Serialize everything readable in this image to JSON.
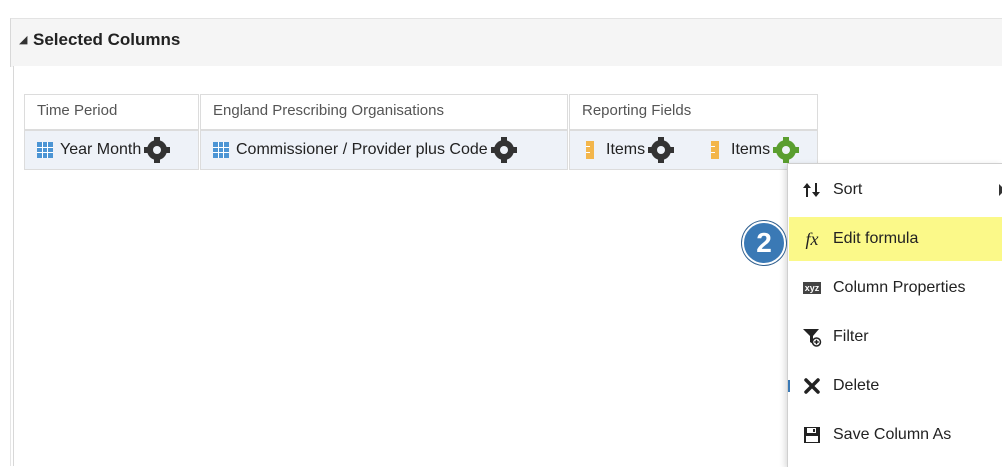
{
  "panel": {
    "title": "Selected Columns"
  },
  "column_groups": [
    {
      "label": "Time Period"
    },
    {
      "label": "England Prescribing Organisations"
    },
    {
      "label": "Reporting Fields"
    }
  ],
  "columns": [
    {
      "label": "Year Month",
      "type": "dimension"
    },
    {
      "label": "Commissioner / Provider plus Code",
      "type": "dimension"
    },
    {
      "label": "Items",
      "type": "measure"
    },
    {
      "label": "Items",
      "type": "measure"
    }
  ],
  "context_menu": {
    "items": [
      {
        "label": "Sort",
        "icon": "sort-icon",
        "has_submenu": true
      },
      {
        "label": "Edit formula",
        "icon": "fx-icon",
        "highlighted": true
      },
      {
        "label": "Column Properties",
        "icon": "xyz-icon"
      },
      {
        "label": "Filter",
        "icon": "filter-icon"
      },
      {
        "label": "Delete",
        "icon": "delete-icon"
      },
      {
        "label": "Save Column As",
        "icon": "save-icon"
      }
    ]
  },
  "step_badge": "2",
  "icon_texts": {
    "fx": "fx",
    "xyz": "xyz"
  },
  "colors": {
    "highlight": "#fbf989",
    "badge": "#3a79b5",
    "gear_active": "#5a9e2f",
    "dimension_icon": "#4c95d4",
    "measure_icon": "#f3b64b"
  }
}
